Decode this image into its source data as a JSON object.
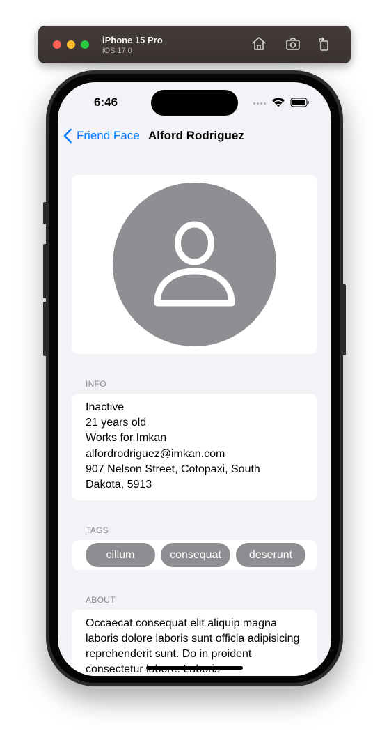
{
  "simulator": {
    "device": "iPhone 15 Pro",
    "os": "iOS 17.0",
    "icons": [
      "home-icon",
      "screenshot-icon",
      "rotate-icon"
    ]
  },
  "status_bar": {
    "time": "6:46",
    "icons": [
      "signal-icon",
      "wifi-icon",
      "battery-icon"
    ]
  },
  "nav": {
    "back_label": "Friend Face",
    "title": "Alford Rodriguez"
  },
  "avatar": {
    "icon": "person-icon"
  },
  "info": {
    "header": "INFO",
    "lines": [
      "Inactive",
      "21 years old",
      "Works for Imkan",
      "alfordrodriguez@imkan.com",
      "907 Nelson Street, Cotopaxi, South",
      "Dakota, 5913"
    ]
  },
  "tags": {
    "header": "TAGS",
    "items": [
      "cillum",
      "consequat",
      "deserunt"
    ]
  },
  "about": {
    "header": "ABOUT",
    "text": "Occaecat consequat elit aliquip magna laboris dolore laboris sunt officia adipisicing reprehenderit sunt. Do in proident consectetur labore. Laboris"
  },
  "colors": {
    "accent": "#007aff",
    "background": "#f2f2f7",
    "card": "#ffffff",
    "tag": "#8e8e93",
    "secondary_text": "#8a8a8e"
  }
}
